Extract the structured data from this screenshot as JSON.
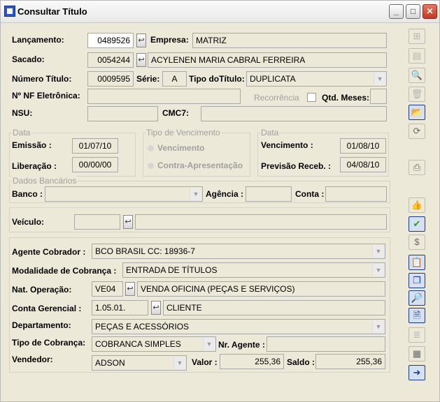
{
  "window": {
    "title": "Consultar Título",
    "controls": {
      "minimize": "_",
      "maximize": "□",
      "close": "✕"
    }
  },
  "form": {
    "lancamento": {
      "label": "Lançamento:",
      "value": "0489526"
    },
    "empresa": {
      "label": "Empresa:",
      "value": "MATRIZ"
    },
    "sacado": {
      "label": "Sacado:",
      "code": "0054244",
      "name": "ACYLENEN MARIA CABRAL FERREIRA"
    },
    "numero_titulo": {
      "label": "Número Título:",
      "value": "0009595"
    },
    "serie": {
      "label": "Série:",
      "value": "A"
    },
    "tipo_titulo": {
      "label": "Tipo doTítulo:",
      "value": "DUPLICATA"
    },
    "nf_eletronica": {
      "label": "Nº NF Eletrônica:",
      "value": ""
    },
    "recorrencia": {
      "label": "Recorrência",
      "checked": false
    },
    "qtd_meses": {
      "label": "Qtd. Meses:",
      "value": ""
    },
    "nsu": {
      "label": "NSU:",
      "value": ""
    },
    "cmc7": {
      "label": "CMC7:",
      "value": ""
    },
    "data_left": {
      "group_title": "Data",
      "emissao": {
        "label": "Emissão :",
        "value": "01/07/10"
      },
      "liberacao": {
        "label": "Liberação :",
        "value": "00/00/00"
      }
    },
    "tipo_vencimento": {
      "group_title": "Tipo de Vencimento",
      "options": [
        "Vencimento",
        "Contra-Apresentação"
      ]
    },
    "data_right": {
      "group_title": "Data",
      "vencimento": {
        "label": "Vencimento :",
        "value": "01/08/10"
      },
      "previsao": {
        "label": "Previsão Receb. :",
        "value": "04/08/10"
      }
    },
    "dados_bancarios": {
      "group_title": "Dados Bancários",
      "banco": {
        "label": "Banco :",
        "value": ""
      },
      "agencia": {
        "label": "Agência :",
        "value": ""
      },
      "conta": {
        "label": "Conta :",
        "value": ""
      }
    },
    "veiculo": {
      "label": "Veículo:",
      "code": "",
      "desc": ""
    },
    "agente_cobrador": {
      "label": "Agente Cobrador :",
      "value": "BCO BRASIL CC: 18936-7"
    },
    "modalidade": {
      "label": "Modalidade de Cobrança :",
      "value": "ENTRADA DE TÍTULOS"
    },
    "nat_operacao": {
      "label": "Nat. Operação:",
      "code": "VE04",
      "desc": "VENDA OFICINA (PEÇAS E SERVIÇOS)"
    },
    "conta_gerencial": {
      "label": "Conta Gerencial :",
      "code": "1.05.01.",
      "desc": "CLIENTE"
    },
    "departamento": {
      "label": "Departamento:",
      "value": "PEÇAS E ACESSÓRIOS"
    },
    "tipo_cobranca": {
      "label": "Tipo de Cobrança:",
      "value": "COBRANCA SIMPLES"
    },
    "nr_agente": {
      "label": "Nr. Agente :",
      "value": ""
    },
    "vendedor": {
      "label": "Vendedor:",
      "value": "ADSON"
    },
    "valor": {
      "label": "Valor :",
      "value": "255,36"
    },
    "saldo": {
      "label": "Saldo :",
      "value": "255,36"
    }
  },
  "toolbar": [
    {
      "name": "insert-row-icon",
      "glyph": "⊞",
      "state": "disabled"
    },
    {
      "name": "edit-table-icon",
      "glyph": "▤",
      "state": "disabled"
    },
    {
      "name": "preview-icon",
      "glyph": "🔍",
      "state": "disabled"
    },
    {
      "name": "trash-icon",
      "glyph": "🗑",
      "state": "disabled"
    },
    {
      "name": "open-folder-icon",
      "glyph": "📂",
      "state": "active"
    },
    {
      "name": "refresh-icon",
      "glyph": "⟳",
      "state": "normal"
    },
    {
      "name": "print-icon",
      "glyph": "⎙",
      "state": "normal"
    },
    {
      "name": "thumbs-up-icon",
      "glyph": "👍",
      "state": "normal"
    },
    {
      "name": "checkmark-icon",
      "glyph": "✔",
      "state": "green"
    },
    {
      "name": "money-bag-icon",
      "glyph": "$",
      "state": "normal"
    },
    {
      "name": "clipboard-icon",
      "glyph": "📋",
      "state": "active"
    },
    {
      "name": "copy-icon",
      "glyph": "❐",
      "state": "active"
    },
    {
      "name": "search-document-icon",
      "glyph": "🔎",
      "state": "active"
    },
    {
      "name": "report-icon",
      "glyph": "🗎",
      "state": "active"
    },
    {
      "name": "list-search-icon",
      "glyph": "≣",
      "state": "disabled"
    },
    {
      "name": "calculator-icon",
      "glyph": "▦",
      "state": "normal"
    },
    {
      "name": "exit-icon",
      "glyph": "➜",
      "state": "active"
    }
  ],
  "colors": {
    "window_bg": "#ece9d8",
    "field_bg": "#ece9d8",
    "active_field": "#ffffff",
    "disabled_text": "#a0a0a0"
  }
}
